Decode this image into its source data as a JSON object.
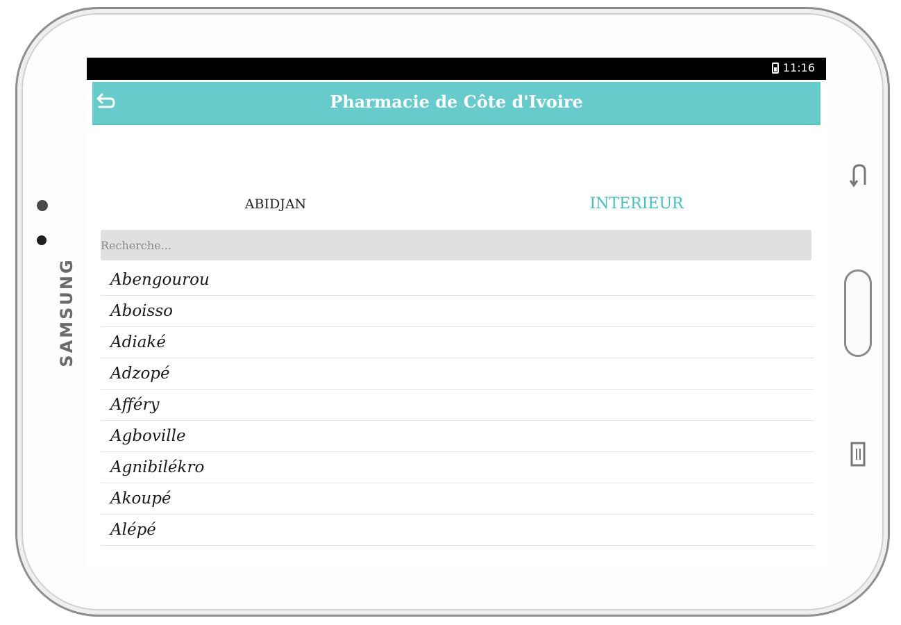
{
  "device": {
    "brand": "SAMSUNG"
  },
  "statusbar": {
    "time": "11:16",
    "battery_icon": "battery-icon"
  },
  "appbar": {
    "title": "Pharmacie de Côte d'Ivoire",
    "back_icon": "back-arrow-icon",
    "color": "#66cccb"
  },
  "tabs": [
    {
      "label": "ABIDJAN",
      "active": false
    },
    {
      "label": "INTERIEUR",
      "active": true,
      "color": "#3ec3c0"
    }
  ],
  "search": {
    "placeholder": "Recherche...",
    "value": ""
  },
  "cities": [
    "Abengourou",
    "Aboisso",
    "Adiaké",
    "Adzopé",
    "Afféry",
    "Agboville",
    "Agnibilékro",
    "Akoupé",
    "Alépé"
  ]
}
